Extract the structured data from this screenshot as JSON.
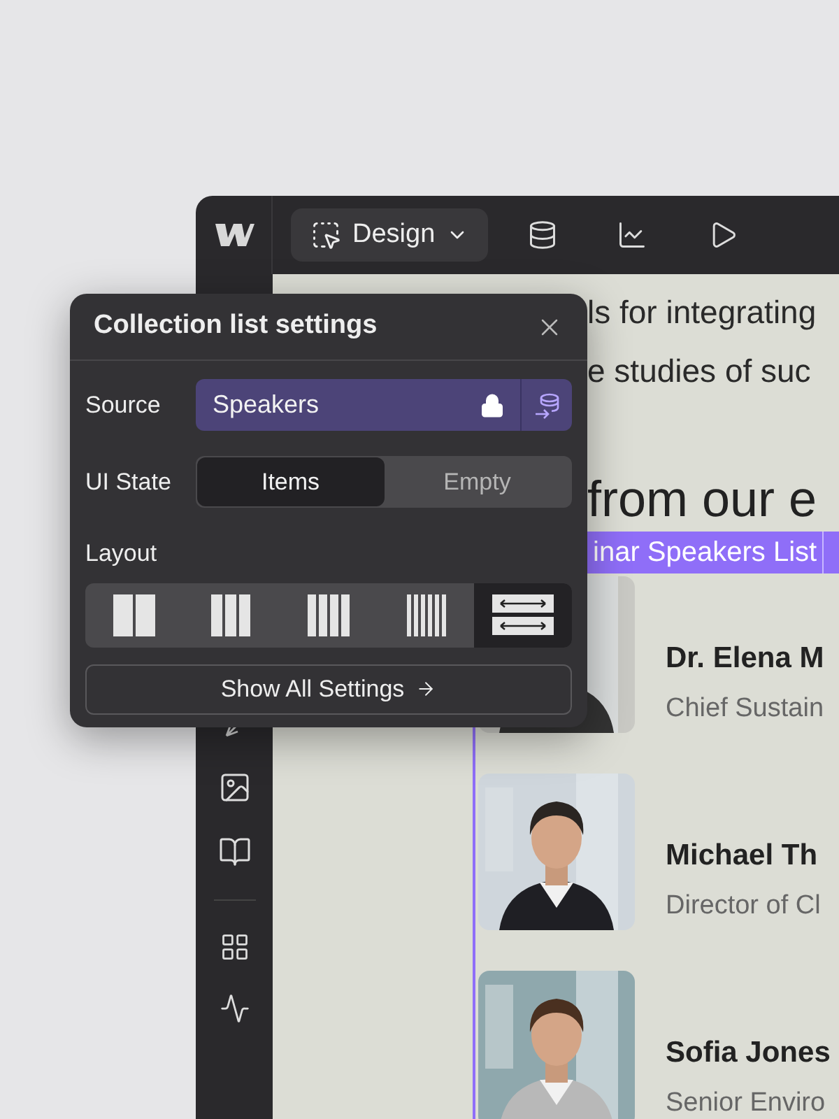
{
  "toolbar": {
    "mode_button": "Design"
  },
  "canvas": {
    "text_lines": [
      "ls for integrating",
      "e studies of suc"
    ],
    "heading": "from our e",
    "collection_label": "inar Speakers List",
    "speakers": [
      {
        "name": "Dr. Elena M",
        "title": "Chief Sustain"
      },
      {
        "name": "Michael Th",
        "title": "Director of Cl"
      },
      {
        "name": "Sofia Jones",
        "title": "Senior Enviro"
      }
    ]
  },
  "dialog": {
    "title": "Collection list settings",
    "source": {
      "label": "Source",
      "value": "Speakers",
      "locked": true
    },
    "ui_state": {
      "label": "UI State",
      "options": [
        {
          "label": "Items",
          "selected": true
        },
        {
          "label": "Empty",
          "selected": false
        }
      ]
    },
    "layout": {
      "label": "Layout",
      "options": [
        {
          "kind": "two",
          "selected": false
        },
        {
          "kind": "three",
          "selected": false
        },
        {
          "kind": "four",
          "selected": false
        },
        {
          "kind": "six",
          "selected": false
        },
        {
          "kind": "rows",
          "selected": true
        }
      ]
    },
    "show_all_button": "Show All Settings"
  }
}
